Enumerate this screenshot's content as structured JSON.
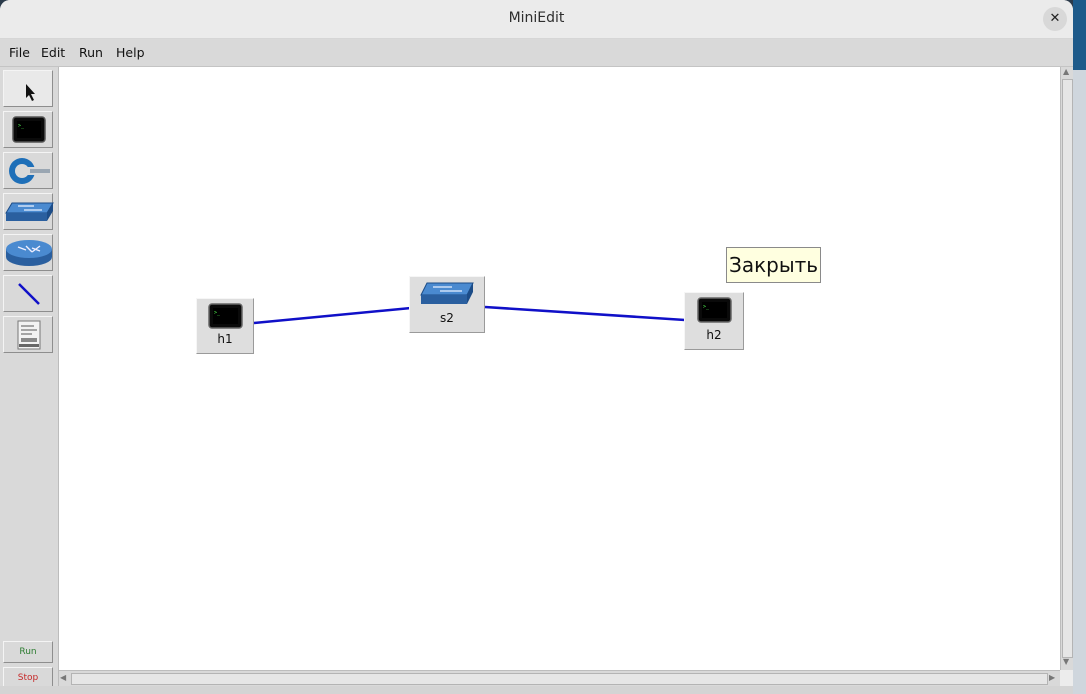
{
  "window": {
    "title": "MiniEdit",
    "close_glyph": "✕"
  },
  "menu": {
    "items": [
      "File",
      "Edit",
      "Run",
      "Help"
    ]
  },
  "toolbar": {
    "tools": [
      "select-icon",
      "host-icon",
      "controller-icon",
      "switch-icon",
      "router-icon",
      "link-icon",
      "netlink-icon"
    ],
    "run_label": "Run",
    "stop_label": "Stop",
    "run_color": "#2e7d32",
    "stop_color": "#c62828"
  },
  "canvas": {
    "nodes": [
      {
        "label": "h1",
        "type": "host"
      },
      {
        "label": "s2",
        "type": "switch"
      },
      {
        "label": "h2",
        "type": "host"
      }
    ],
    "link_color": "#1010c8",
    "tooltip": "Закрыть"
  }
}
